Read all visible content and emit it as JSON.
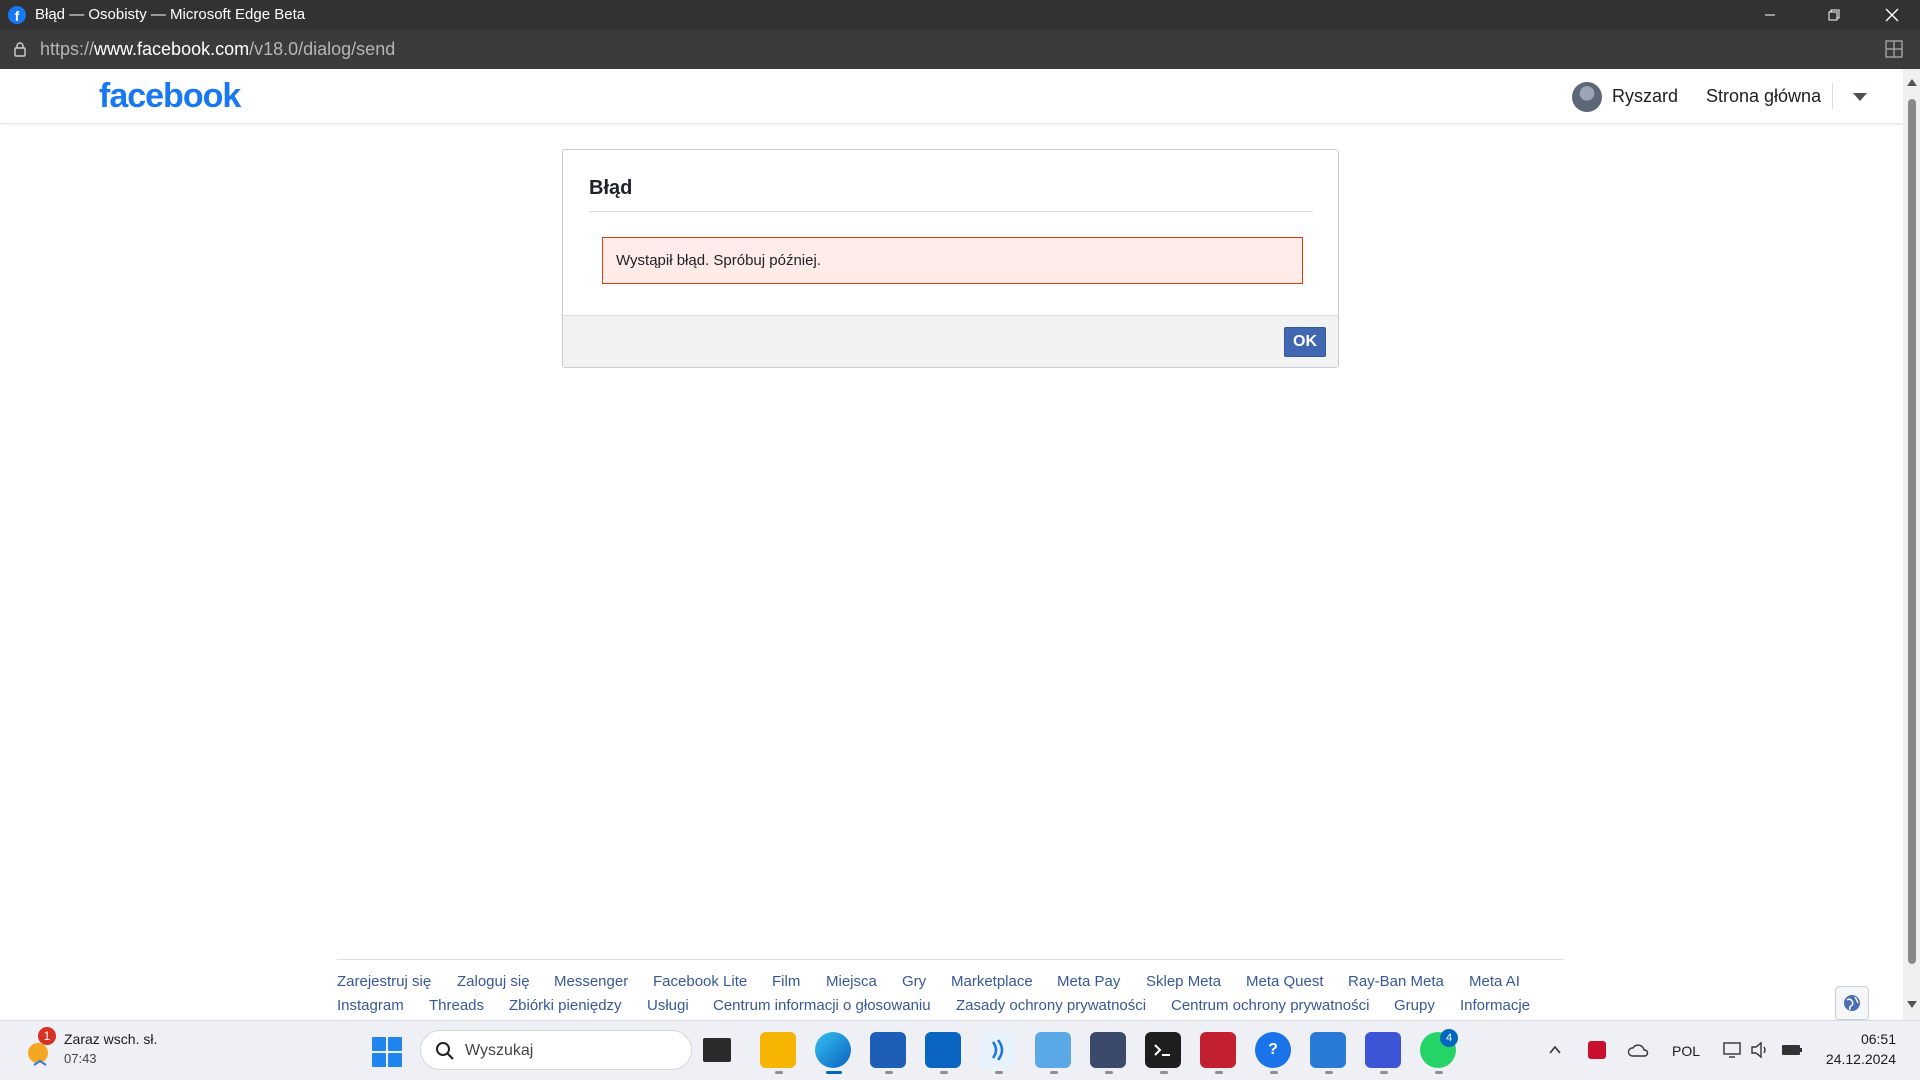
{
  "browser": {
    "window_title": "Błąd — Osobisty — Microsoft Edge Beta",
    "favicon_letter": "f",
    "url_scheme": "https://",
    "url_domain": "www.facebook.com",
    "url_path": "/v18.0/dialog/send"
  },
  "header": {
    "logo": "facebook",
    "user_name": "Ryszard",
    "home_link": "Strona główna"
  },
  "dialog": {
    "title": "Błąd",
    "error_message": "Wystąpił błąd. Spróbuj później.",
    "ok_label": "OK"
  },
  "footer": {
    "row1": [
      "Zarejestruj się",
      "Zaloguj się",
      "Messenger",
      "Facebook Lite",
      "Film",
      "Miejsca",
      "Gry",
      "Marketplace",
      "Meta Pay",
      "Sklep Meta",
      "Meta Quest",
      "Ray-Ban Meta",
      "Meta AI"
    ],
    "row2": [
      "Instagram",
      "Threads",
      "Zbiórki pieniędzy",
      "Usługi",
      "Centrum informacji o głosowaniu",
      "Zasady ochrony prywatności",
      "Centrum ochrony prywatności",
      "Grupy",
      "Informacje"
    ]
  },
  "taskbar": {
    "weather_text": "Zaraz wsch. sł.",
    "weather_time": "07:43",
    "weather_badge": "1",
    "search_placeholder": "Wyszukaj",
    "whatsapp_badge": "4",
    "language": "POL",
    "clock_time": "06:51",
    "clock_date": "24.12.2024"
  },
  "colors": {
    "facebook_blue": "#1877f2",
    "button_blue": "#4267b2",
    "error_bg": "#ffebe8",
    "error_border": "#dd3c10",
    "link": "#385898"
  }
}
